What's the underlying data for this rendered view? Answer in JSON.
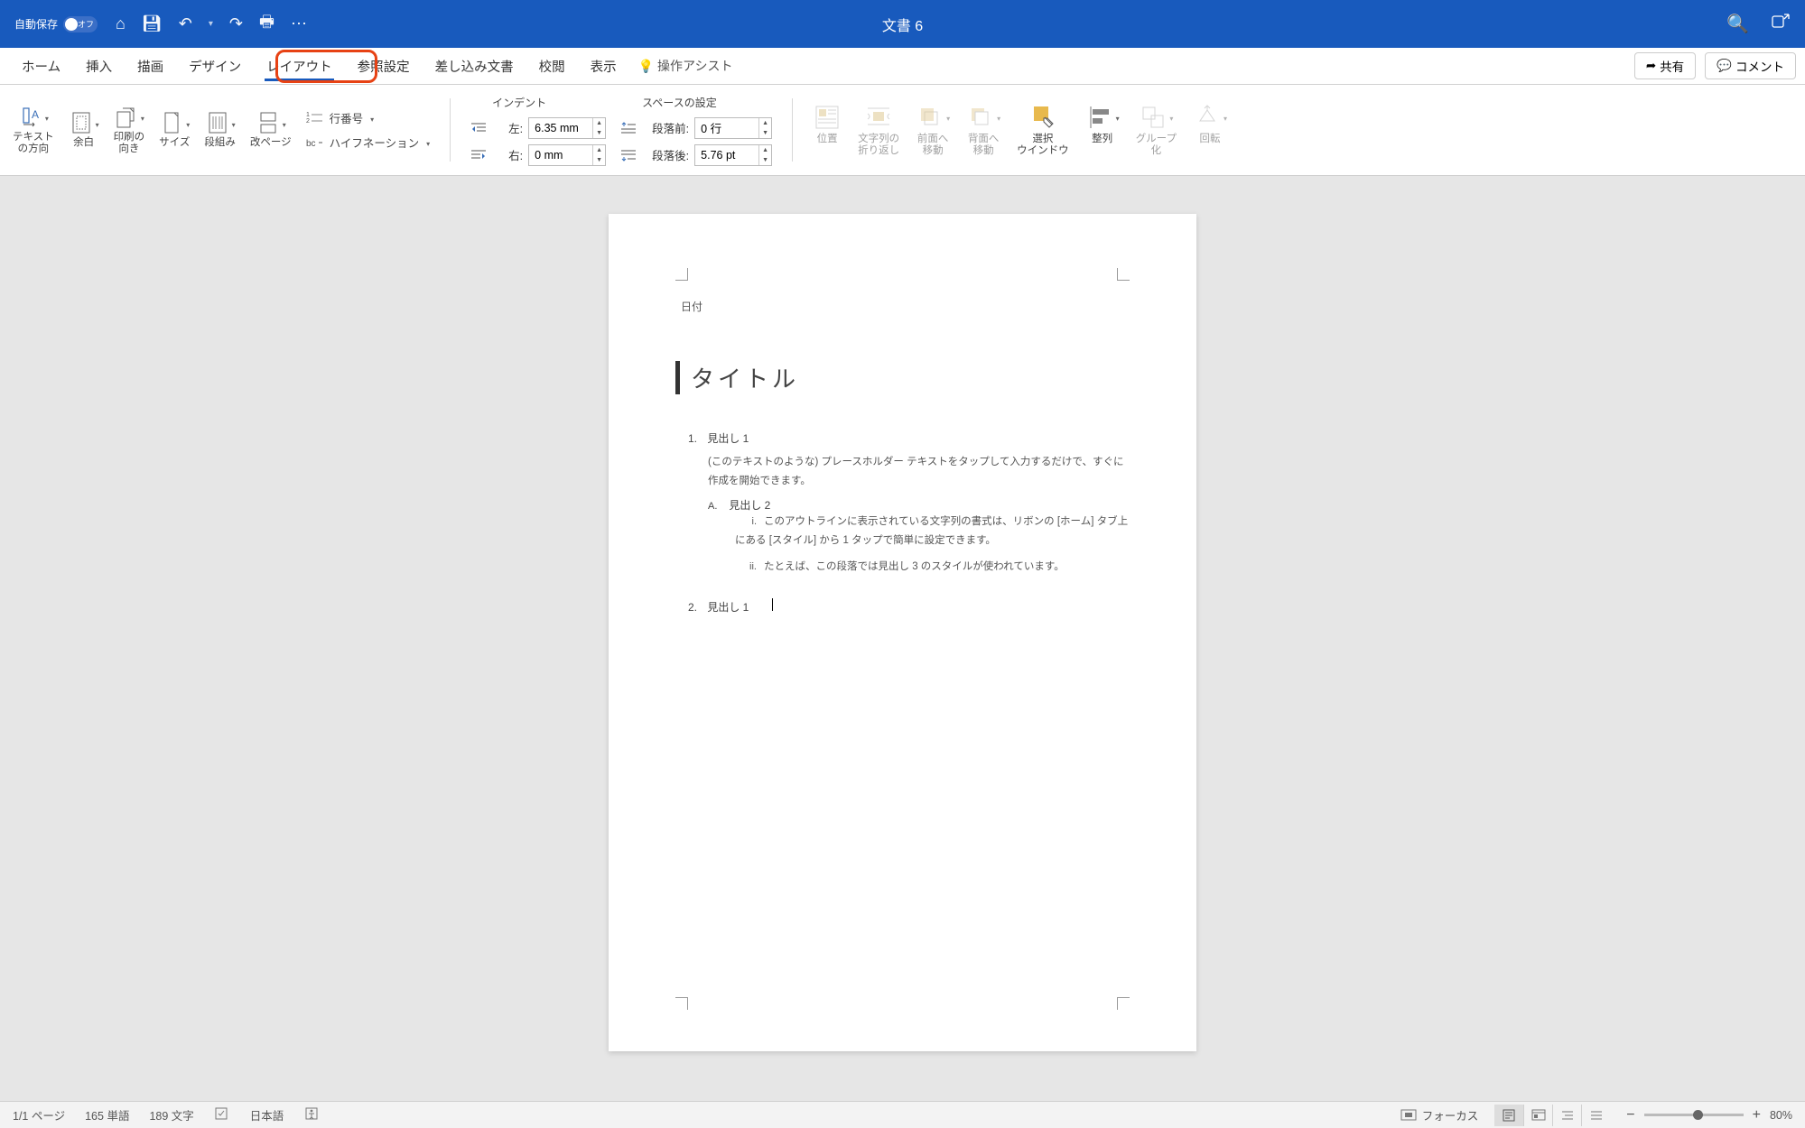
{
  "titlebar": {
    "autosave_label": "自動保存",
    "autosave_state": "オフ",
    "doc_title": "文書 6"
  },
  "tabs": {
    "home": "ホーム",
    "insert": "挿入",
    "draw": "描画",
    "design": "デザイン",
    "layout": "レイアウト",
    "references": "参照設定",
    "mail": "差し込み文書",
    "review": "校閲",
    "view": "表示",
    "assist": "操作アシスト",
    "share": "共有",
    "comment": "コメント"
  },
  "ribbon": {
    "text_direction": "テキスト\nの方向",
    "margins": "余白",
    "orientation": "印刷の\n向き",
    "size": "サイズ",
    "columns": "段組み",
    "breaks": "改ページ",
    "line_numbers": "行番号",
    "hyphenation": "ハイフネーション",
    "indent_title": "インデント",
    "left_label": "左:",
    "right_label": "右:",
    "left_value": "6.35 mm",
    "right_value": "0 mm",
    "spacing_title": "スペースの設定",
    "before_label": "段落前:",
    "after_label": "段落後:",
    "before_value": "0 行",
    "after_value": "5.76 pt",
    "position": "位置",
    "wrap": "文字列の\n折り返し",
    "bring_forward": "前面へ\n移動",
    "send_backward": "背面へ\n移動",
    "selection": "選択\nウインドウ",
    "align": "整列",
    "group": "グループ\n化",
    "rotate": "回転"
  },
  "doc": {
    "date": "日付",
    "title": "タイトル",
    "h1_1_num": "1.",
    "h1_1": "見出し 1",
    "body1": "(このテキストのような) プレースホルダー テキストをタップして入力するだけで、すぐに作成を開始できます。",
    "h2_a_num": "A.",
    "h2_a": "見出し 2",
    "li_i_num": "i.",
    "li_i": "このアウトラインに表示されている文字列の書式は、リボンの [ホーム] タブ上にある [スタイル] から 1 タップで簡単に設定できます。",
    "li_ii_num": "ii.",
    "li_ii": "たとえば、この段落では見出し 3 のスタイルが使われています。",
    "h1_2_num": "2.",
    "h1_2": "見出し 1"
  },
  "status": {
    "page": "1/1 ページ",
    "words": "165 単語",
    "chars": "189 文字",
    "lang": "日本語",
    "focus": "フォーカス",
    "zoom": "80%"
  }
}
